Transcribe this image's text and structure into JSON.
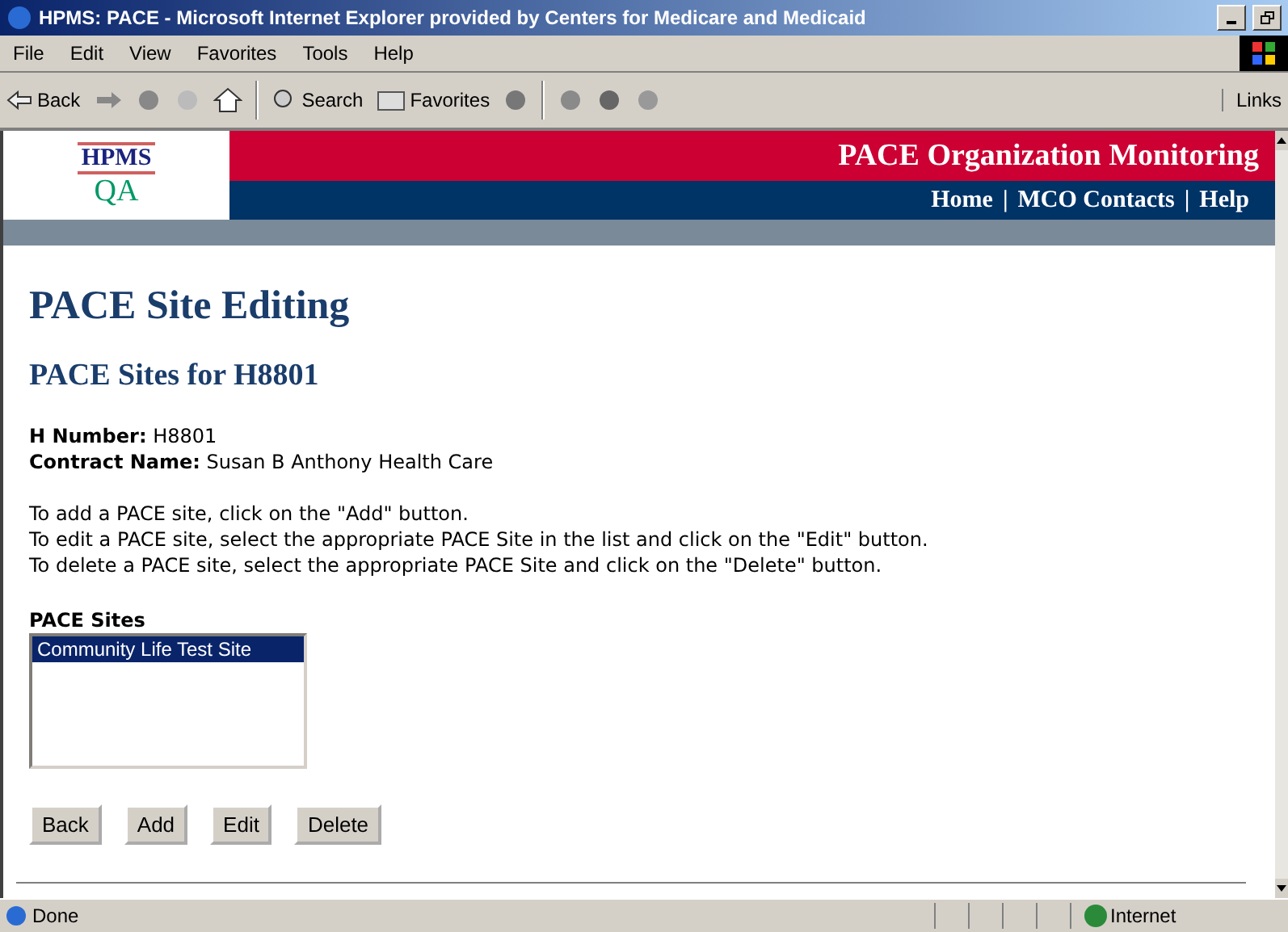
{
  "window": {
    "title": "HPMS: PACE - Microsoft Internet Explorer provided by Centers for Medicare and Medicaid"
  },
  "menu": [
    "File",
    "Edit",
    "View",
    "Favorites",
    "Tools",
    "Help"
  ],
  "toolbar": {
    "back": "Back",
    "search": "Search",
    "favorites": "Favorites",
    "links": "Links"
  },
  "header": {
    "logo_top": "HPMS",
    "logo_bottom": "QA",
    "title": "PACE Organization Monitoring",
    "nav": [
      {
        "label": "Home"
      },
      {
        "label": "MCO Contacts"
      },
      {
        "label": "Help"
      }
    ],
    "separator": "|"
  },
  "page": {
    "heading": "PACE Site Editing",
    "subheading": "PACE Sites for H8801",
    "fields": [
      {
        "label": "H Number:",
        "value": "H8801"
      },
      {
        "label": "Contract Name:",
        "value": "Susan B Anthony Health Care"
      }
    ],
    "instructions": [
      "To add a PACE site, click on the \"Add\" button.",
      "To edit a PACE site, select the appropriate PACE Site in the list and click on the \"Edit\" button.",
      "To delete a PACE site, select the appropriate PACE Site and click on the \"Delete\" button."
    ],
    "list_label": "PACE Sites",
    "sites": [
      {
        "label": "Community Life Test Site",
        "selected": true
      }
    ],
    "buttons": [
      "Back",
      "Add",
      "Edit",
      "Delete"
    ]
  },
  "status_bar": {
    "text": "Done",
    "zone": "Internet"
  }
}
